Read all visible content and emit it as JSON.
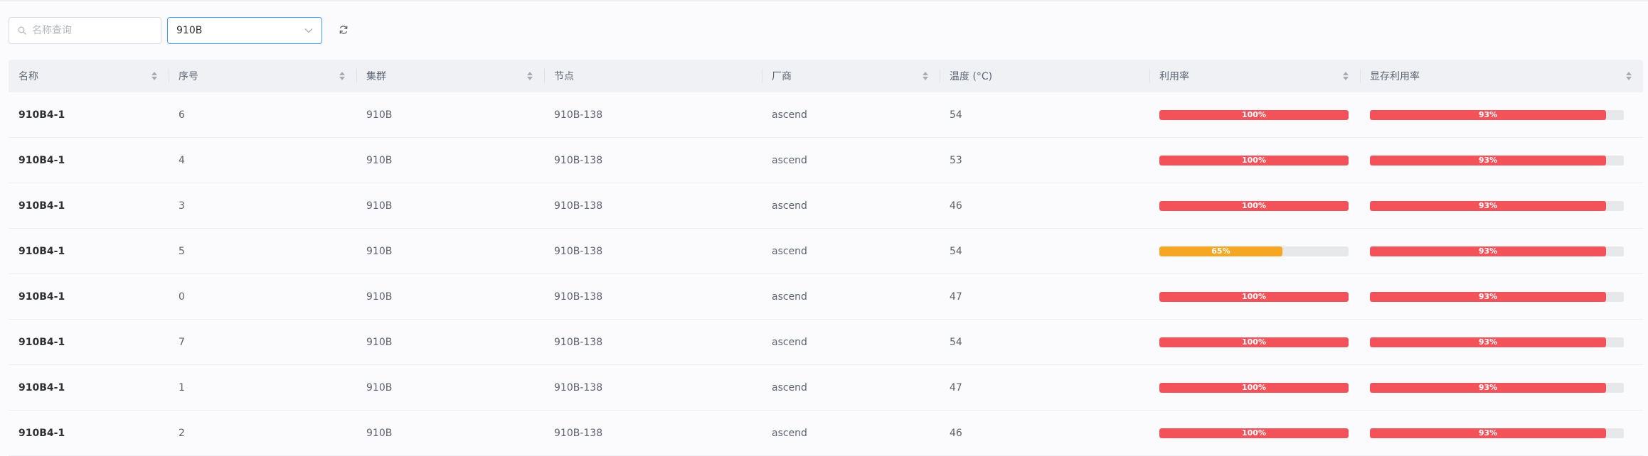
{
  "search": {
    "placeholder": "名称查询",
    "value": ""
  },
  "filter": {
    "selected": "910B"
  },
  "colors": {
    "high": "#f4525b",
    "mid": "#f5a623",
    "track": "#e6e8ec",
    "accent": "#409eff"
  },
  "icons": {
    "search": "search-icon",
    "dropdown": "chevron-down-icon",
    "refresh": "refresh-icon",
    "sort": "sort-icon"
  },
  "table": {
    "headers": [
      "名称",
      "序号",
      "集群",
      "节点",
      "厂商",
      "温度 (°C)",
      "利用率",
      "显存利用率"
    ],
    "rows": [
      {
        "name": "910B4-1",
        "index": "6",
        "cluster": "910B",
        "node": "910B-138",
        "vendor": "ascend",
        "temp": "54",
        "util": 100,
        "util_label": "100%",
        "mem": 93,
        "mem_label": "93%"
      },
      {
        "name": "910B4-1",
        "index": "4",
        "cluster": "910B",
        "node": "910B-138",
        "vendor": "ascend",
        "temp": "53",
        "util": 100,
        "util_label": "100%",
        "mem": 93,
        "mem_label": "93%"
      },
      {
        "name": "910B4-1",
        "index": "3",
        "cluster": "910B",
        "node": "910B-138",
        "vendor": "ascend",
        "temp": "46",
        "util": 100,
        "util_label": "100%",
        "mem": 93,
        "mem_label": "93%"
      },
      {
        "name": "910B4-1",
        "index": "5",
        "cluster": "910B",
        "node": "910B-138",
        "vendor": "ascend",
        "temp": "54",
        "util": 65,
        "util_label": "65%",
        "mem": 93,
        "mem_label": "93%"
      },
      {
        "name": "910B4-1",
        "index": "0",
        "cluster": "910B",
        "node": "910B-138",
        "vendor": "ascend",
        "temp": "47",
        "util": 100,
        "util_label": "100%",
        "mem": 93,
        "mem_label": "93%"
      },
      {
        "name": "910B4-1",
        "index": "7",
        "cluster": "910B",
        "node": "910B-138",
        "vendor": "ascend",
        "temp": "54",
        "util": 100,
        "util_label": "100%",
        "mem": 93,
        "mem_label": "93%"
      },
      {
        "name": "910B4-1",
        "index": "1",
        "cluster": "910B",
        "node": "910B-138",
        "vendor": "ascend",
        "temp": "47",
        "util": 100,
        "util_label": "100%",
        "mem": 93,
        "mem_label": "93%"
      },
      {
        "name": "910B4-1",
        "index": "2",
        "cluster": "910B",
        "node": "910B-138",
        "vendor": "ascend",
        "temp": "46",
        "util": 100,
        "util_label": "100%",
        "mem": 93,
        "mem_label": "93%"
      }
    ]
  }
}
